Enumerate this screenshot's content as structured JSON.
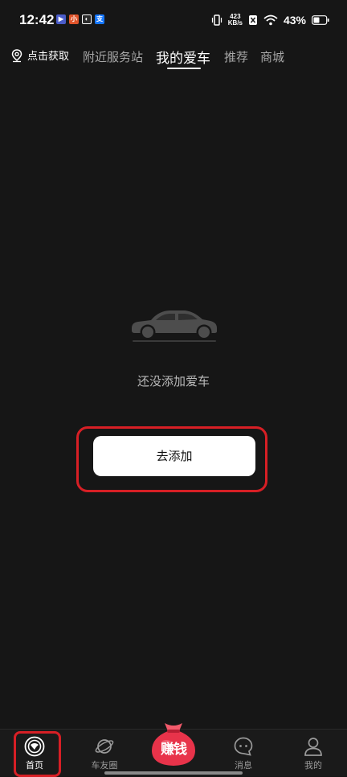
{
  "status_bar": {
    "time": "12:42",
    "net_speed_value": "423",
    "net_speed_unit": "KB/s",
    "battery": "43%",
    "notif_icons": [
      {
        "name": "play-app-icon",
        "glyph": "▶",
        "color": "#4a5cc9"
      },
      {
        "name": "xiaohongshu-app-icon",
        "glyph": "小",
        "color": "#e0542b"
      },
      {
        "name": "weibo-app-icon",
        "glyph": "◐",
        "color": "#2b2b2b"
      },
      {
        "name": "alipay-app-icon",
        "glyph": "支",
        "color": "#1677ff"
      }
    ]
  },
  "top_nav": {
    "location_label": "点击获取",
    "tabs": [
      {
        "label": "附近服务站",
        "active": false
      },
      {
        "label": "我的爱车",
        "active": true
      },
      {
        "label": "推荐",
        "active": false
      },
      {
        "label": "商城",
        "active": false
      }
    ]
  },
  "empty_state": {
    "message": "还没添加爱车",
    "button_label": "去添加"
  },
  "bottom_nav": {
    "items": [
      {
        "label": "首页",
        "icon": "home-orbit-icon",
        "active": true
      },
      {
        "label": "车友圈",
        "icon": "planet-icon",
        "active": false
      },
      {
        "label": "消息",
        "icon": "chat-bubble-icon",
        "active": false
      },
      {
        "label": "我的",
        "icon": "person-icon",
        "active": false
      }
    ],
    "earn_label": "赚钱"
  },
  "colors": {
    "background": "#161616",
    "highlight": "#d71f25",
    "button_bg": "#ffffff",
    "earn_red": "#e8334a"
  }
}
